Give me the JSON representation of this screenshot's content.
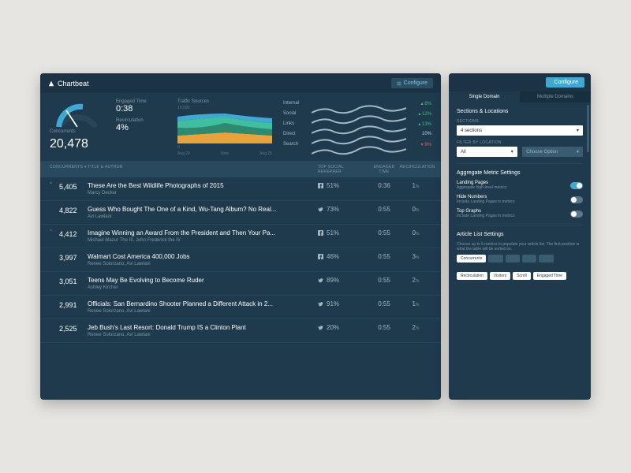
{
  "brand": {
    "name": "Chartbeat"
  },
  "header": {
    "configure": "Configure"
  },
  "overview": {
    "concurrents_label": "Concurrents",
    "concurrents_value": "20,478",
    "engaged_time_label": "Engaged Time",
    "engaged_time_value": "0:38",
    "recirculation_label": "Recirculation",
    "recirculation_value": "4%",
    "traffic_sources_label": "Traffic Sources",
    "chart_ymax": "10,000",
    "chart_ymin": "0",
    "chart_xstart": "Aug 24",
    "chart_xmid": "Now",
    "chart_xend": "Aug 25"
  },
  "chart_data": {
    "type": "area",
    "title": "Traffic Sources",
    "xlabel": "",
    "ylabel": "",
    "ylim": [
      0,
      10000
    ],
    "categories": [
      "Aug 24",
      "",
      "",
      "Now",
      "",
      "",
      "Aug 25"
    ],
    "series": [
      {
        "name": "Internal",
        "values": [
          3500,
          3000,
          3200,
          3400,
          3300,
          3600,
          3200
        ]
      },
      {
        "name": "Social",
        "values": [
          1800,
          2200,
          2500,
          2100,
          2300,
          2000,
          1900
        ]
      },
      {
        "name": "Links",
        "values": [
          1200,
          1500,
          1700,
          1400,
          1600,
          1300,
          1200
        ]
      },
      {
        "name": "Direct",
        "values": [
          900,
          900,
          800,
          900,
          900,
          900,
          900
        ]
      },
      {
        "name": "Search",
        "values": [
          600,
          700,
          600,
          700,
          600,
          600,
          600
        ]
      }
    ]
  },
  "sources": [
    {
      "name": "Internal",
      "delta": "8%",
      "dir": "up"
    },
    {
      "name": "Social",
      "delta": "12%",
      "dir": "up"
    },
    {
      "name": "Links",
      "delta": "13%",
      "dir": "up"
    },
    {
      "name": "Direct",
      "delta": "10%",
      "dir": "none"
    },
    {
      "name": "Search",
      "delta": "9%",
      "dir": "down"
    }
  ],
  "columns": {
    "concurrents": "CONCURRENTS ▾",
    "title": "TITLE & AUTHOR",
    "social": "TOP SOCIAL REFERRER",
    "engaged": "ENGAGED TIME",
    "recirc": "RECIRCULATION"
  },
  "articles": [
    {
      "caret": "^",
      "concurrents": "5,405",
      "title": "These Are the Best Wildlife Photographs of 2015",
      "author": "Marcy Decker",
      "social_net": "fb",
      "social_pct": "51%",
      "engaged": "0:36",
      "recirc": "1"
    },
    {
      "caret": "",
      "concurrents": "4,822",
      "title": "Guess Who Bought The One of a Kind, Wu-Tang Album? No Real...",
      "author": "Avi Lawlani",
      "social_net": "tw",
      "social_pct": "73%",
      "engaged": "0:55",
      "recirc": "0"
    },
    {
      "caret": "^",
      "concurrents": "4,412",
      "title": "Imagine Winning an Award From the President and Then Your Pa...",
      "author": "Michael Mazur The III, John Frederick the IV",
      "social_net": "fb",
      "social_pct": "51%",
      "engaged": "0:55",
      "recirc": "0"
    },
    {
      "caret": "",
      "concurrents": "3,997",
      "title": "Walmart Cost America 400,000 Jobs",
      "author": "Renee Solorzano, Avi Lawlani",
      "social_net": "fb",
      "social_pct": "46%",
      "engaged": "0:55",
      "recirc": "3"
    },
    {
      "caret": "",
      "concurrents": "3,051",
      "title": "Teens May Be Evolving to Become Ruder",
      "author": "Ashley Kircher",
      "social_net": "tw",
      "social_pct": "89%",
      "engaged": "0:55",
      "recirc": "2"
    },
    {
      "caret": "",
      "concurrents": "2,991",
      "title": "Officials: San Bernardino Shooter Planned a Different Attack in 2...",
      "author": "Renee Solorzano, Avi Lawlani",
      "social_net": "tw",
      "social_pct": "91%",
      "engaged": "0:55",
      "recirc": "1"
    },
    {
      "caret": "",
      "concurrents": "2,525",
      "title": "Jeb Bush's Last Resort: Donald Trump IS a Clinton Plant",
      "author": "Renee Solorzano, Avi Lawlani",
      "social_net": "tw",
      "social_pct": "20%",
      "engaged": "0:55",
      "recirc": "2"
    }
  ],
  "panel": {
    "configure": "Configure",
    "tab1": "Single Domain",
    "tab2": "Multiple Domains",
    "sections_title": "Sections & Locations",
    "sections_field": "SECTIONS",
    "sections_value": "4 sections",
    "filter_field": "FILTER BY LOCATION",
    "filter_value": "All",
    "choose_option": "Choose Option",
    "agg_title": "Aggregate Metric Settings",
    "toggles": [
      {
        "label": "Landing Pages",
        "sub": "Aggregate high-level metrics",
        "on": true
      },
      {
        "label": "Hide Numbers",
        "sub": "Include Landing Pages in metrics",
        "on": false
      },
      {
        "label": "Top Graphs",
        "sub": "Include Landing Pages in metrics",
        "on": false
      }
    ],
    "article_title": "Article List Settings",
    "article_sub": "Choose up to 5 metrics to populate your article list. The first position is what the table will be sorted on.",
    "selected_chips": [
      "Concurrents",
      "",
      "",
      "",
      ""
    ],
    "available_chips": [
      "Recirculation",
      "Visitors",
      "Scroll",
      "Engaged Time"
    ]
  }
}
